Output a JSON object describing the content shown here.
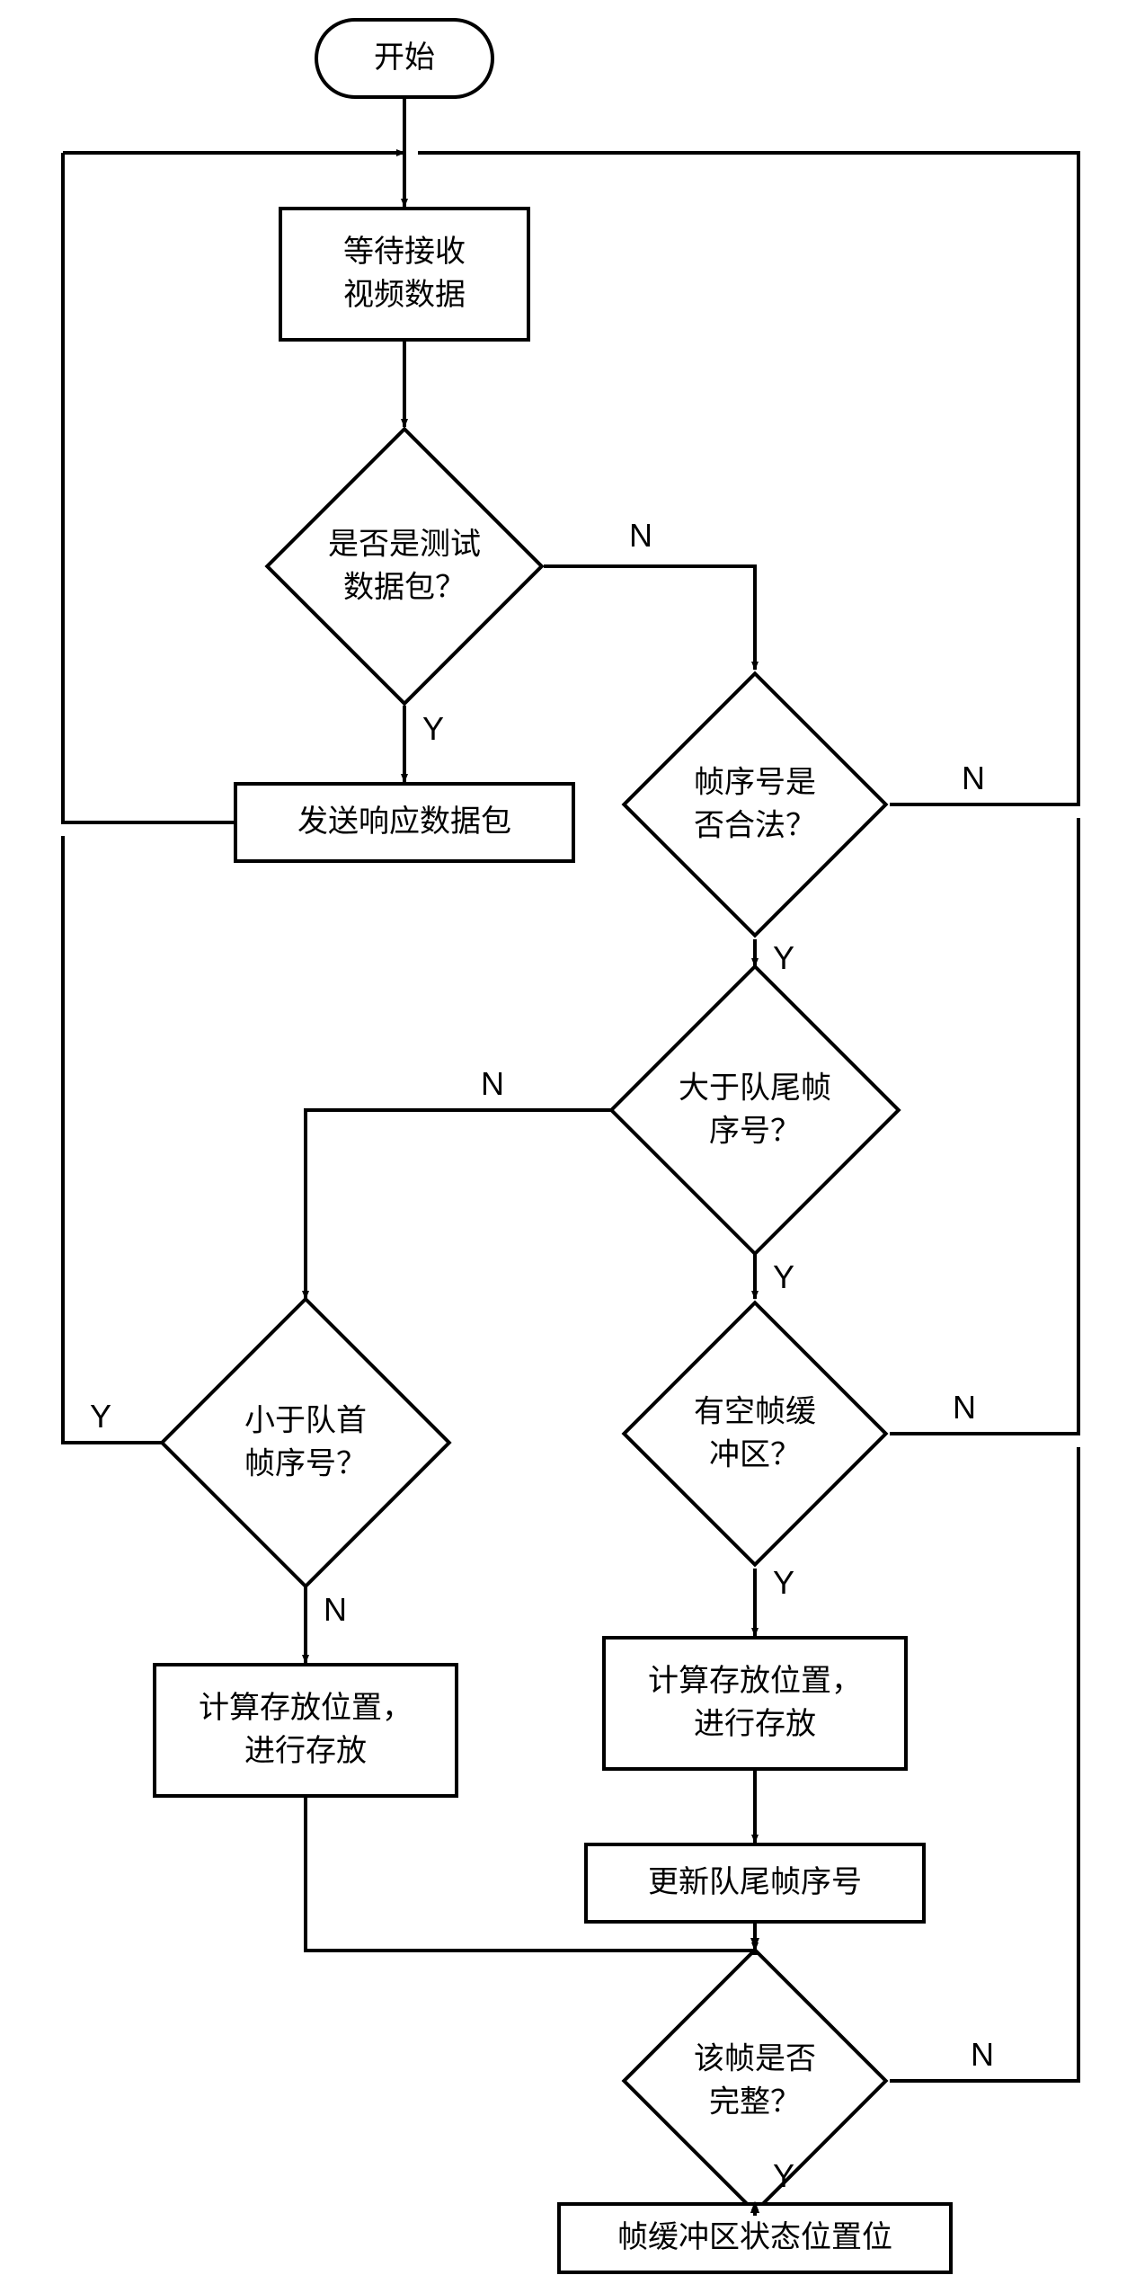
{
  "nodes": {
    "start": "开始",
    "wait_recv": "等待接收\n视频数据",
    "is_test_pkt": "是否是测试\n数据包？",
    "send_resp": "发送响应数据包",
    "seq_valid": "帧序号是\n否合法？",
    "gt_tail": "大于队尾帧\n序号？",
    "lt_head": "小于队首\n帧序号？",
    "has_empty_buf": "有空帧缓\n冲区？",
    "calc_store_left": "计算存放位置，\n进行存放",
    "calc_store_right": "计算存放位置，\n进行存放",
    "update_tail": "更新队尾帧序号",
    "frame_complete": "该帧是否\n完整？",
    "set_status_bit": "帧缓冲区状态位置位"
  },
  "labels": {
    "yes": "Y",
    "no": "N"
  }
}
